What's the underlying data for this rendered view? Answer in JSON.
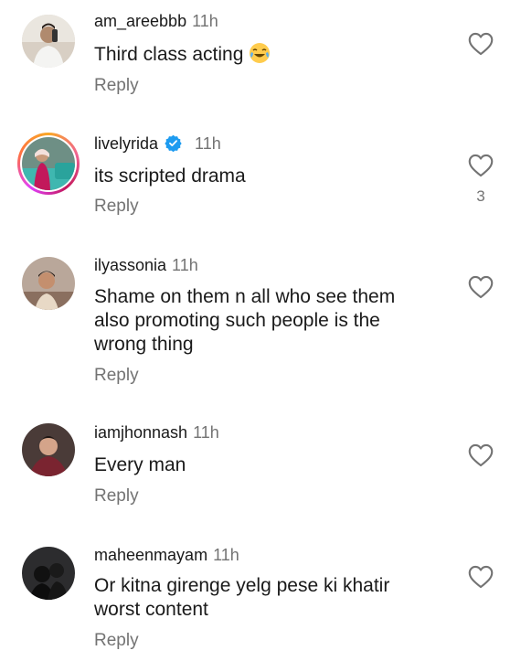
{
  "comments": [
    {
      "username": "am_areebbb",
      "time": "11h",
      "text_lines": [
        "Third class acting"
      ],
      "emoji": "tears-of-joy-emoji",
      "reply": "Reply",
      "verified": false,
      "likes": ""
    },
    {
      "username": "livelyrida",
      "time": "11h",
      "text_lines": [
        "its scripted drama"
      ],
      "reply": "Reply",
      "verified": true,
      "likes": "3"
    },
    {
      "username": "ilyassonia",
      "time": "11h",
      "text_lines": [
        "Shame on them n all who see them",
        "also promoting such people is the",
        "wrong thing"
      ],
      "reply": "Reply",
      "verified": false,
      "likes": ""
    },
    {
      "username": "iamjhonnash",
      "time": "11h",
      "text_lines": [
        "Every man"
      ],
      "reply": "Reply",
      "verified": false,
      "likes": ""
    },
    {
      "username": "maheenmayam",
      "time": "11h",
      "text_lines": [
        "Or kitna girenge yelg pese ki khatir",
        "worst content"
      ],
      "reply": "Reply",
      "verified": false,
      "likes": ""
    }
  ],
  "icons": {
    "like": "heart-outline-icon",
    "verified": "verified-badge-icon"
  },
  "colors": {
    "verified": "#1d9bf0",
    "muted": "#737373",
    "text": "#1a1a1a"
  }
}
